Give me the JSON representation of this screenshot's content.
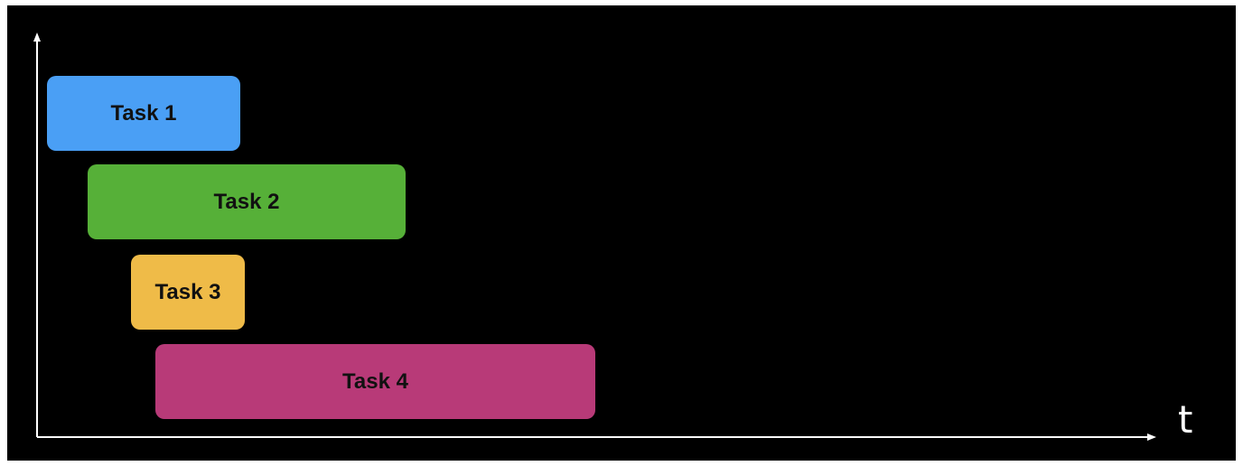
{
  "axis": {
    "x_label": "t"
  },
  "tasks": [
    {
      "label": "Task 1",
      "color": "#4a9ff5"
    },
    {
      "label": "Task 2",
      "color": "#56b038"
    },
    {
      "label": "Task 3",
      "color": "#efbb48"
    },
    {
      "label": "Task 4",
      "color": "#b83a78"
    }
  ],
  "colors": {
    "background": "#000000",
    "axis": "#ffffff"
  }
}
